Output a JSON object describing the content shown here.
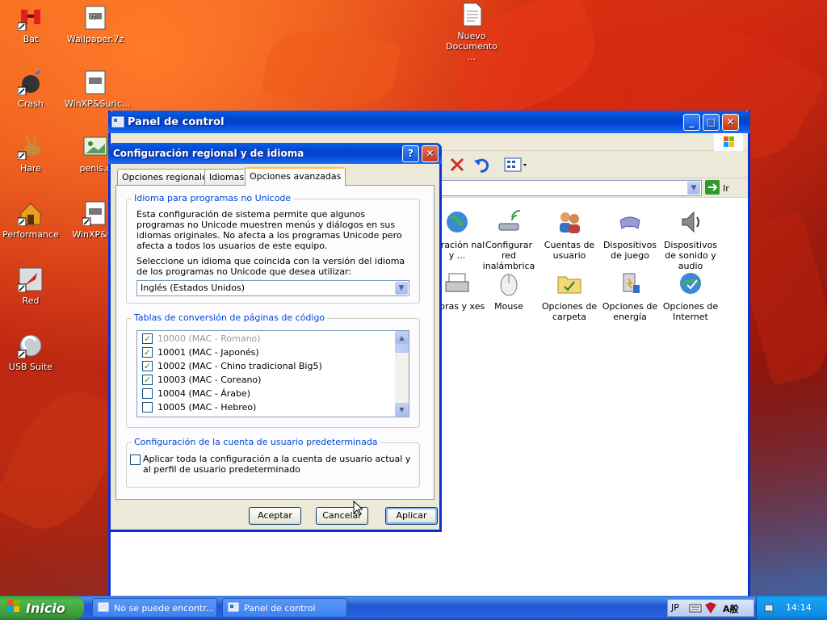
{
  "desktop": {
    "icons": [
      {
        "label": "Bat",
        "icon": "bat-shortcut-icon"
      },
      {
        "label": "Crash",
        "icon": "crash-shortcut-icon"
      },
      {
        "label": "Hare",
        "icon": "hare-shortcut-icon"
      },
      {
        "label": "Performance",
        "icon": "performance-shortcut-icon"
      },
      {
        "label": "Red",
        "icon": "red-shortcut-icon"
      },
      {
        "label": "USB Suite",
        "icon": "usb-suite-shortcut-icon"
      },
      {
        "label": "Wallpaper.7z",
        "icon": "archive-icon"
      },
      {
        "label": "WinXP&Suric...",
        "icon": "archive-icon"
      },
      {
        "label": "penis.c",
        "icon": "image-file-icon"
      },
      {
        "label": "WinXP&Su",
        "icon": "archive-icon"
      },
      {
        "label": "Nuevo Documento ...",
        "icon": "text-document-icon"
      }
    ]
  },
  "control_panel": {
    "title": "Panel de control",
    "go_label": "Ir",
    "items": [
      {
        "label": "guración nal y ...",
        "icon": "regional-globe-icon"
      },
      {
        "label": "Configurar red inalámbrica",
        "icon": "wireless-network-icon"
      },
      {
        "label": "Cuentas de usuario",
        "icon": "user-accounts-icon"
      },
      {
        "label": "Dispositivos de juego",
        "icon": "game-controller-icon"
      },
      {
        "label": "Dispositivos de sonido y audio",
        "icon": "speaker-icon"
      },
      {
        "label": "esoras y xes",
        "icon": "printer-icon"
      },
      {
        "label": "Mouse",
        "icon": "mouse-icon"
      },
      {
        "label": "Opciones de carpeta",
        "icon": "folder-options-icon"
      },
      {
        "label": "Opciones de energía",
        "icon": "power-options-icon"
      },
      {
        "label": "Opciones de Internet",
        "icon": "internet-options-icon"
      }
    ]
  },
  "dialog": {
    "title": "Configuración regional y de idioma",
    "tabs": [
      "Opciones regionales",
      "Idiomas",
      "Opciones avanzadas"
    ],
    "active_tab": "Opciones avanzadas",
    "non_unicode": {
      "legend": "Idioma para programas no Unicode",
      "description": "Esta configuración de sistema permite que algunos programas no Unicode muestren menús y diálogos en sus idiomas originales. No afecta a los programas Unicode pero afecta a todos los usuarios de este equipo.",
      "instruction": "Seleccione un idioma que coincida con la versión del idioma de los programas no Unicode que desea utilizar:",
      "selected_language": "Inglés (Estados Unidos)"
    },
    "code_pages": {
      "legend": "Tablas de conversión de páginas de código",
      "rows": [
        {
          "label": "10000 (MAC - Romano)",
          "checked": true,
          "disabled": true
        },
        {
          "label": "10001 (MAC - Japonés)",
          "checked": true,
          "disabled": false
        },
        {
          "label": "10002 (MAC - Chino tradicional Big5)",
          "checked": true,
          "disabled": false
        },
        {
          "label": "10003 (MAC - Coreano)",
          "checked": true,
          "disabled": false
        },
        {
          "label": "10004 (MAC - Árabe)",
          "checked": false,
          "disabled": false
        },
        {
          "label": "10005 (MAC - Hebreo)",
          "checked": false,
          "disabled": false
        }
      ]
    },
    "default_user": {
      "legend": "Configuración de la cuenta de usuario predeterminada",
      "checkbox_label": "Aplicar toda la configuración a la cuenta de usuario actual y al perfil de usuario predeterminado",
      "checked": false
    },
    "buttons": {
      "ok": "Aceptar",
      "cancel": "Cancelar",
      "apply": "Aplicar"
    }
  },
  "taskbar": {
    "start_label": "Inicio",
    "tasks": [
      {
        "label": "No se puede encontr...",
        "active": false
      },
      {
        "label": "Panel de control",
        "active": false
      }
    ],
    "language": "JP",
    "ime_label": "A般",
    "clock": "14:14"
  }
}
